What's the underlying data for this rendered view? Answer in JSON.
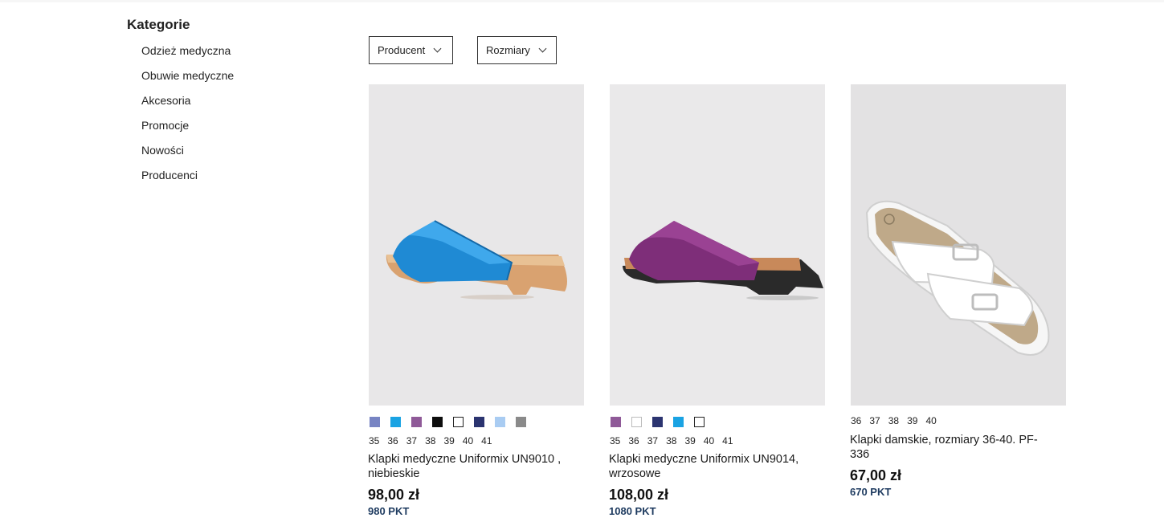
{
  "sidebar": {
    "title": "Kategorie",
    "items": [
      {
        "label": "Odzież medyczna"
      },
      {
        "label": "Obuwie medyczne"
      },
      {
        "label": "Akcesoria"
      },
      {
        "label": "Promocje"
      },
      {
        "label": "Nowości"
      },
      {
        "label": "Producenci"
      }
    ]
  },
  "filters": {
    "producent_label": "Producent",
    "rozmiary_label": "Rozmiary",
    "chevron_icon": "chevron-down-icon"
  },
  "products": [
    {
      "name": "Klapki medyczne Uniformix UN9010 , niebieskie",
      "price": "98,00 zł",
      "points": "980 PKT",
      "image_icon": "blue-clog-image",
      "colors": [
        "#7784c3",
        "#1aa3e3",
        "#8f5a98",
        "#0d0d0d",
        "#ffffff",
        "#2b3470",
        "#a9ccf2",
        "#8a8a8a"
      ],
      "sizes": [
        "35",
        "36",
        "37",
        "38",
        "39",
        "40",
        "41"
      ]
    },
    {
      "name": "Klapki medyczne Uniformix UN9014, wrzosowe",
      "price": "108,00 zł",
      "points": "1080 PKT",
      "image_icon": "purple-clog-image",
      "colors": [
        "#8f5a98",
        "#ffffff",
        "#2b3470",
        "#1aa3e3",
        "#ffffff"
      ],
      "sizes": [
        "35",
        "36",
        "37",
        "38",
        "39",
        "40",
        "41"
      ]
    },
    {
      "name": "Klapki damskie, rozmiary 36-40. PF-336",
      "price": "67,00 zł",
      "points": "670 PKT",
      "image_icon": "white-sandal-image",
      "colors": [],
      "sizes": [
        "36",
        "37",
        "38",
        "39",
        "40"
      ]
    }
  ]
}
